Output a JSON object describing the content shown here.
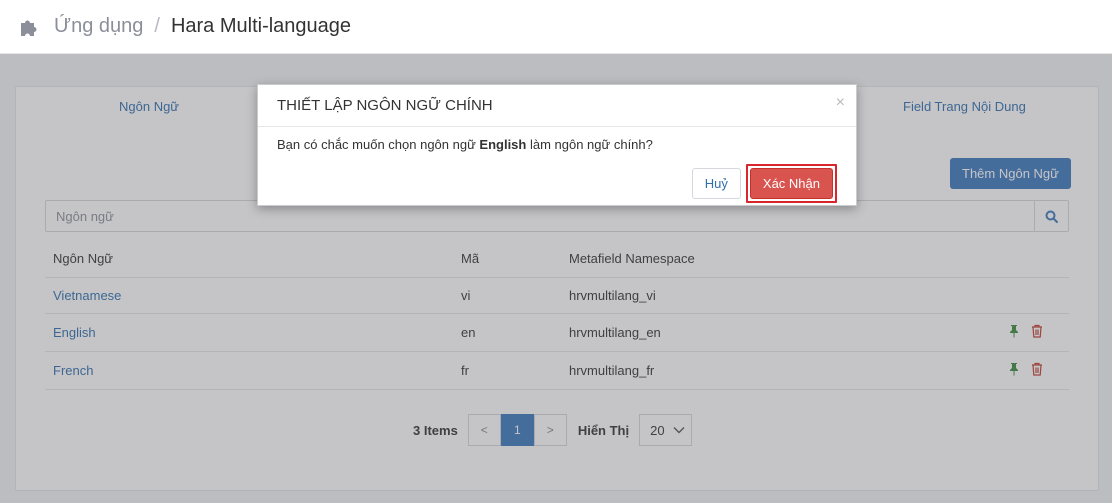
{
  "header": {
    "app_label": "Ứng dụng",
    "separator": "/",
    "current_page": "Hara Multi-language"
  },
  "tabs": [
    {
      "label": "Ngôn Ngữ"
    },
    {
      "label": "Field Trang Nội Dung"
    }
  ],
  "toolbar": {
    "add_language_label": "Thêm Ngôn Ngữ"
  },
  "search": {
    "placeholder": "Ngôn ngữ",
    "value": ""
  },
  "table": {
    "headers": [
      "Ngôn Ngữ",
      "Mã",
      "Metafield Namespace"
    ],
    "rows": [
      {
        "name": "Vietnamese",
        "code": "vi",
        "namespace": "hrvmultilang_vi"
      },
      {
        "name": "English",
        "code": "en",
        "namespace": "hrvmultilang_en"
      },
      {
        "name": "French",
        "code": "fr",
        "namespace": "hrvmultilang_fr"
      }
    ]
  },
  "pagination": {
    "items_label": "3 Items",
    "prev": "<",
    "current_page": "1",
    "next": ">",
    "show_label": "Hiển Thị",
    "page_size": "20"
  },
  "modal": {
    "title": "THIẾT LẬP NGÔN NGỮ CHÍNH",
    "close": "×",
    "message_prefix": "Bạn có chắc muốn chọn ngôn ngữ ",
    "message_language": "English",
    "message_suffix": " làm ngôn ngữ chính?",
    "cancel_label": "Huỷ",
    "confirm_label": "Xác Nhận"
  },
  "colors": {
    "primary": "#3a78bd",
    "link": "#2f6fb0",
    "danger": "#d9534f",
    "highlight": "#d9262c",
    "pin": "#3c8a3e"
  },
  "icons": {
    "app": "puzzle-icon",
    "search": "search-icon",
    "pin": "pin-icon",
    "delete": "trash-icon",
    "dropdown": "chevron-down-icon"
  }
}
